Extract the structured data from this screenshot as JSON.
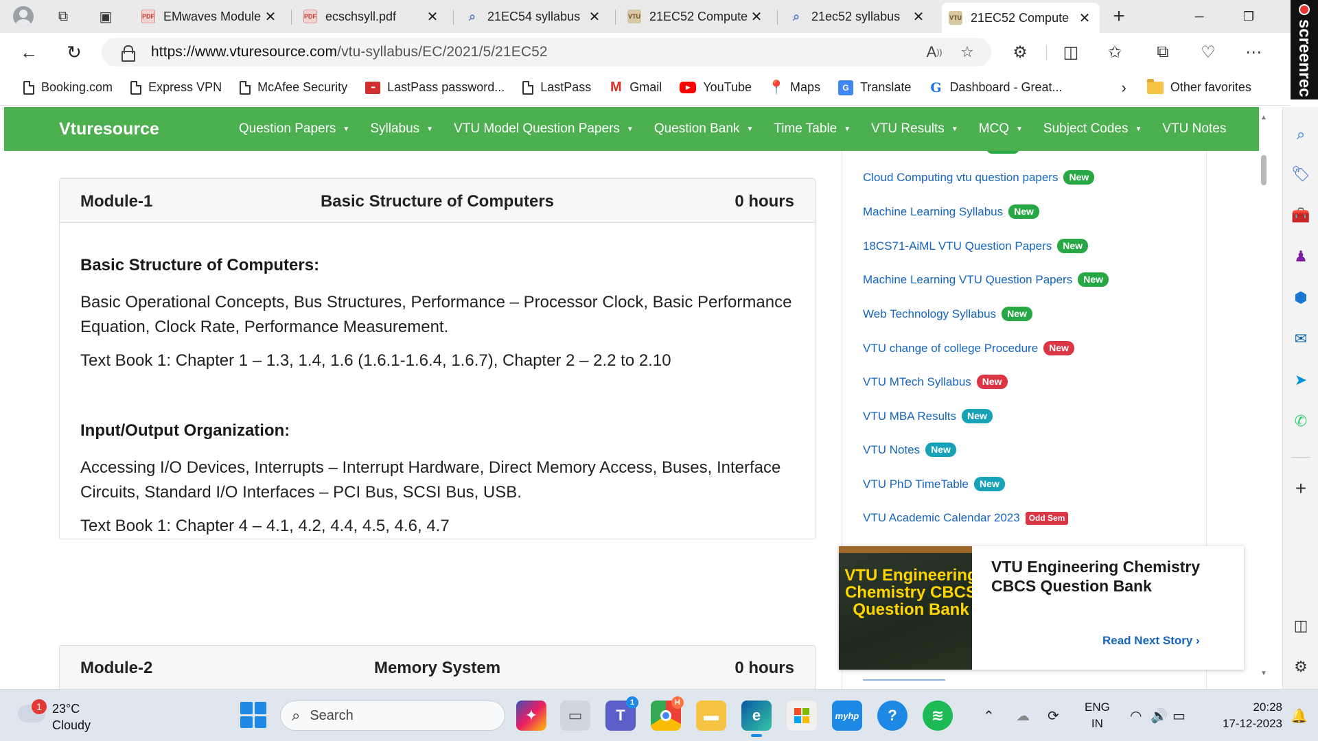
{
  "browser": {
    "tabs": [
      {
        "title": "EMwaves Module",
        "favicon": "pdf-icon",
        "active": false
      },
      {
        "title": "ecschsyll.pdf",
        "favicon": "pdf-icon",
        "active": false
      },
      {
        "title": "21EC54 syllabus",
        "favicon": "search-icon",
        "active": false
      },
      {
        "title": "21EC52 Compute",
        "favicon": "vtu-icon",
        "active": false
      },
      {
        "title": "21ec52 syllabus",
        "favicon": "search-icon",
        "active": false
      },
      {
        "title": "21EC52 Compute",
        "favicon": "vtu-icon",
        "active": true
      }
    ],
    "url_host": "https://www.vturesource.com",
    "url_path": "/vtu-syllabus/EC/2021/5/21EC52",
    "favorites": [
      {
        "label": "Booking.com",
        "icon": "page-icon"
      },
      {
        "label": "Express VPN",
        "icon": "page-icon"
      },
      {
        "label": "McAfee Security",
        "icon": "page-icon"
      },
      {
        "label": "LastPass password...",
        "icon": "lastpass-icon"
      },
      {
        "label": "LastPass",
        "icon": "page-icon"
      },
      {
        "label": "Gmail",
        "icon": "gmail-icon"
      },
      {
        "label": "YouTube",
        "icon": "youtube-icon"
      },
      {
        "label": "Maps",
        "icon": "maps-icon"
      },
      {
        "label": "Translate",
        "icon": "translate-icon"
      },
      {
        "label": "Dashboard - Great...",
        "icon": "google-icon"
      }
    ],
    "other_favorites": "Other favorites"
  },
  "site": {
    "logo": "Vturesource",
    "nav": [
      {
        "label": "Question Papers",
        "dropdown": true
      },
      {
        "label": "Syllabus",
        "dropdown": true
      },
      {
        "label": "VTU Model Question Papers",
        "dropdown": true
      },
      {
        "label": "Question Bank",
        "dropdown": true
      },
      {
        "label": "Time Table",
        "dropdown": true
      },
      {
        "label": "VTU Results",
        "dropdown": true
      },
      {
        "label": "MCQ",
        "dropdown": true
      },
      {
        "label": "Subject Codes",
        "dropdown": true
      },
      {
        "label": "VTU Notes",
        "dropdown": false
      }
    ],
    "caret": "▼"
  },
  "modules": [
    {
      "number": "Module-1",
      "title": "Basic Structure of Computers",
      "hours": "0 hours",
      "sections": [
        {
          "heading": "Basic Structure of Computers:",
          "text": "Basic Operational Concepts, Bus Structures, Performance – Processor Clock, Basic Performance Equation, Clock Rate, Performance Measurement.",
          "textbook": "Text Book 1: Chapter 1 – 1.3, 1.4, 1.6 (1.6.1-1.6.4, 1.6.7), Chapter 2 – 2.2 to 2.10"
        },
        {
          "heading": "Input/Output Organization:",
          "text": "Accessing I/O Devices, Interrupts – Interrupt Hardware, Direct Memory Access, Buses, Interface Circuits, Standard I/O Interfaces – PCI Bus, SCSI Bus, USB.",
          "textbook": "Text Book 1: Chapter 4 – 4.1, 4.2, 4.4, 4.5, 4.6, 4.7"
        }
      ]
    },
    {
      "number": "Module-2",
      "title": "Memory System",
      "hours": "0 hours"
    }
  ],
  "sidebar_links": [
    {
      "label": "Cloud Computing vtu question papers",
      "badge": "New",
      "badge_color": "green"
    },
    {
      "label": "Machine Learning Syllabus",
      "badge": "New",
      "badge_color": "green"
    },
    {
      "label": "18CS71-AiML VTU Question Papers",
      "badge": "New",
      "badge_color": "green"
    },
    {
      "label": "Machine Learning VTU Question Papers",
      "badge": "New",
      "badge_color": "green"
    },
    {
      "label": "Web Technology Syllabus",
      "badge": "New",
      "badge_color": "green"
    },
    {
      "label": "VTU change of college Procedure",
      "badge": "New",
      "badge_color": "red"
    },
    {
      "label": "VTU MTech Syllabus",
      "badge": "New",
      "badge_color": "red"
    },
    {
      "label": "VTU MBA Results",
      "badge": "New",
      "badge_color": "teal"
    },
    {
      "label": "VTU Notes",
      "badge": "New",
      "badge_color": "teal"
    },
    {
      "label": "VTU PhD TimeTable",
      "badge": "New",
      "badge_color": "teal"
    },
    {
      "label": "VTU Academic Calendar 2023",
      "badge": "Odd Sem",
      "badge_color": "red"
    }
  ],
  "ad": {
    "image_text": "VTU Engineering Chemistry CBCS Question Bank",
    "title": "VTU Engineering Chemistry CBCS Question Bank",
    "read_next": "Read Next Story ›"
  },
  "screenrec_label": "screenrec",
  "taskbar": {
    "weather_temp": "23°C",
    "weather_condition": "Cloudy",
    "weather_badge": "1",
    "search_label": "Search",
    "language": "ENG",
    "region": "IN",
    "time": "20:28",
    "date": "17-12-2023"
  },
  "colors": {
    "site_nav": "#4caf50",
    "link": "#1565c0",
    "badge_green": "#28a745",
    "badge_red": "#dc3545",
    "badge_teal": "#17a2b8",
    "ad_text": "#ffd400"
  }
}
